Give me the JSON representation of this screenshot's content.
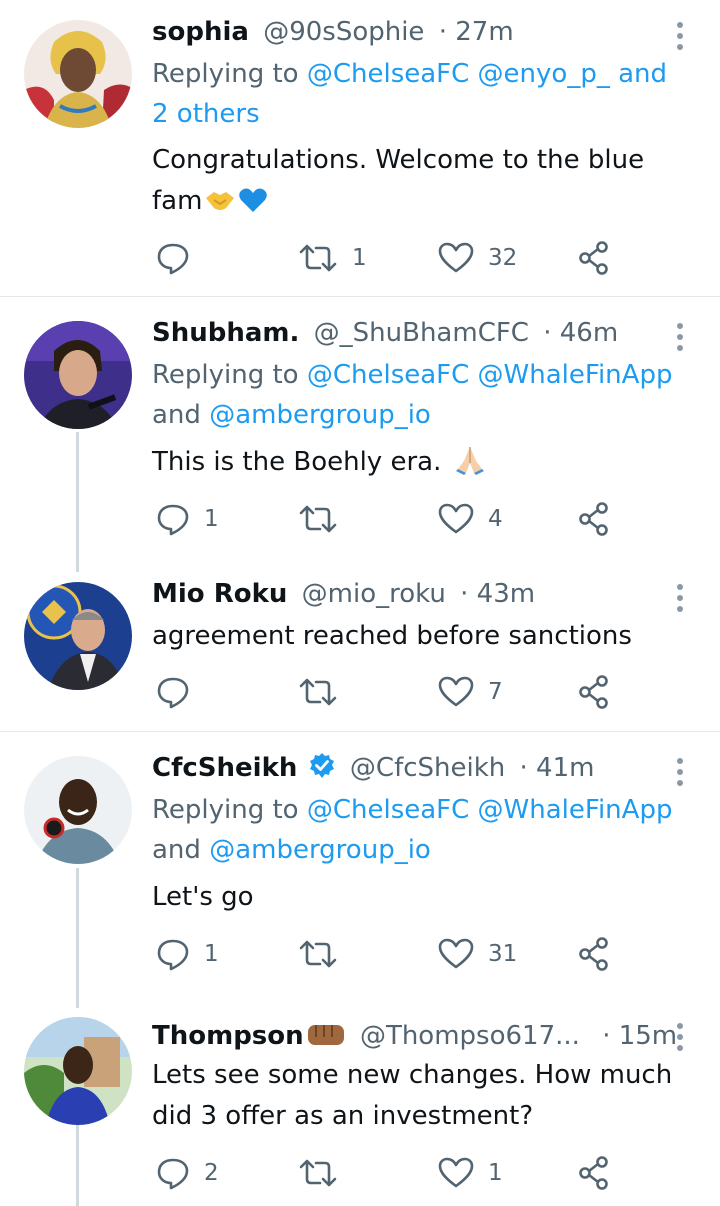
{
  "tweets": [
    {
      "name": "sophia",
      "handle": "@90sSophie",
      "time": "· 27m",
      "replying_prefix": "Replying to ",
      "replying_links": "@ChelseaFC @enyo_p_",
      "replying_suffix": " and",
      "replying_line2": "2 others",
      "body": [
        "Congratulations. Welcome to the blue",
        "fam"
      ],
      "emoji": [
        "handshake-emoji",
        "blue-heart-emoji"
      ],
      "replies": "",
      "retweets": "1",
      "likes": "32"
    },
    {
      "name": "Shubham.",
      "handle": "@_ShuBhamCFC",
      "time": "· 46m",
      "replying_prefix": "Replying to ",
      "replying_links": "@ChelseaFC @WhaleFinApp",
      "replying_line2_prefix": "and ",
      "replying_line2": "@ambergroup_io",
      "body": [
        "This is the Boehly era."
      ],
      "emoji": [
        "folded-hands-emoji"
      ],
      "replies": "1",
      "retweets": "",
      "likes": "4"
    },
    {
      "name": "Mio Roku",
      "handle": "@mio_roku",
      "time": "· 43m",
      "body": [
        "agreement reached before sanctions"
      ],
      "replies": "",
      "retweets": "",
      "likes": "7"
    },
    {
      "name": "CfcSheikh",
      "handle": "@CfcSheikh",
      "time": "· 41m",
      "verified": true,
      "replying_prefix": "Replying to ",
      "replying_links": "@ChelseaFC @WhaleFinApp",
      "replying_line2_prefix": "and ",
      "replying_line2": "@ambergroup_io",
      "body": [
        "Let's go"
      ],
      "replies": "1",
      "retweets": "",
      "likes": "31"
    },
    {
      "name": "Thompson",
      "handle": "@Thompso617...",
      "time": "· 15m",
      "emoji": [
        "fist-emoji"
      ],
      "body": [
        "Lets see some new changes. How much",
        "did 3 offer as an investment?"
      ],
      "replies": "2",
      "retweets": "",
      "likes": "1"
    }
  ],
  "colors": {
    "link": "#1d9bf0",
    "meta": "#536471",
    "text": "#0f1419",
    "verified": "#1d9bf0",
    "divider": "#e4e8eb",
    "thread_line": "#cfd9de"
  }
}
